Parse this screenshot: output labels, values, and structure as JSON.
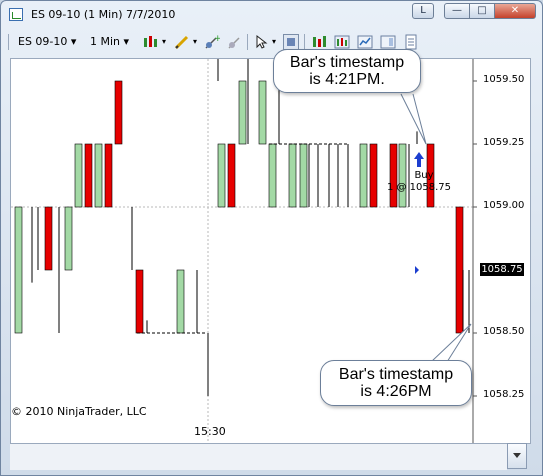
{
  "window": {
    "title": "ES 09-10 (1 Min)  7/7/2010",
    "buttons": {
      "l": "L"
    }
  },
  "toolbar": {
    "instrument": "ES 09-10",
    "interval": "1 Min"
  },
  "chart_data": {
    "type": "bar",
    "style": "renko-like boxes",
    "ylim": [
      1058.2,
      1059.6
    ],
    "yticks": [
      1059.5,
      1059.25,
      1059.0,
      1058.75,
      1058.5,
      1058.25
    ],
    "ytick_labels": [
      "1059.50",
      "1059.25",
      "1059.00",
      "1058.75",
      "1058.50",
      "1058.25"
    ],
    "xlabel_time": "15:30",
    "current_price": "1058.75",
    "up_color": "#a3d9a5",
    "down_color": "#e60000",
    "signal": {
      "label": "Buy",
      "detail": "1 @ 1058.75",
      "arrow_color": "#1c3ecf"
    }
  },
  "callouts": {
    "first": {
      "line1": "Bar's timestamp",
      "line2": "is 4:21PM."
    },
    "second": {
      "line1": "Bar's timestamp",
      "line2": "is 4:26PM"
    }
  },
  "footer": {
    "copyright": "© 2010 NinjaTrader, LLC"
  }
}
